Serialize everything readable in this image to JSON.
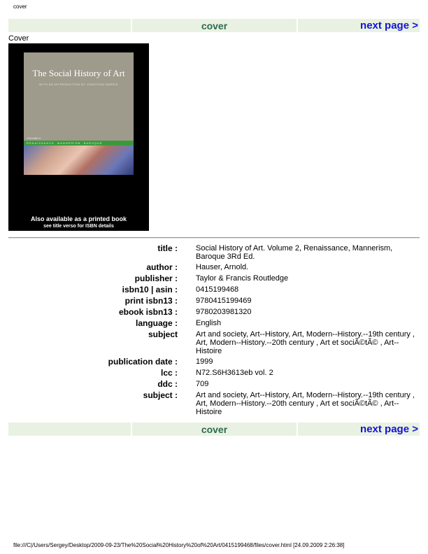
{
  "header": {
    "title": "cover"
  },
  "nav": {
    "cover_label": "cover",
    "next_label": "next page >"
  },
  "cover_section": {
    "label": "Cover",
    "book_title": "The Social History of Art",
    "introduction": "WITH AN INTRODUCTION BY JONATHAN HARRIS",
    "volume": "VOLUME II",
    "subtitle": "RENAISSANCE, MANNERISM, BAROQUE",
    "printed_note": "Also available as a printed book",
    "isbn_note": "see title verso for ISBN details"
  },
  "metadata": [
    {
      "label": "title :",
      "value": "Social History of Art. Volume 2, Renaissance, Mannerism, Baroque 3Rd Ed."
    },
    {
      "label": "author :",
      "value": "Hauser, Arnold."
    },
    {
      "label": "publisher :",
      "value": "Taylor & Francis Routledge"
    },
    {
      "label": "isbn10 | asin :",
      "value": "0415199468"
    },
    {
      "label": "print isbn13 :",
      "value": "9780415199469"
    },
    {
      "label": "ebook isbn13 :",
      "value": "9780203981320"
    },
    {
      "label": "language :",
      "value": "English"
    },
    {
      "label": "subject",
      "value": "Art and society, Art--History, Art, Modern--History.--19th century , Art, Modern--History.--20th century , Art et sociÃ©tÃ© , Art--Histoire"
    },
    {
      "label": "publication date :",
      "value": "1999"
    },
    {
      "label": "lcc :",
      "value": "N72.S6H3613eb vol. 2"
    },
    {
      "label": "ddc :",
      "value": "709"
    },
    {
      "label": "subject :",
      "value": "Art and society, Art--History, Art, Modern--History.--19th century , Art, Modern--History.--20th century , Art et sociÃ©tÃ© , Art--Histoire"
    }
  ],
  "footer": {
    "path": "file:///C|/Users/Sergey/Desktop/2009-09-23/The%20Social%20History%20of%20Art/0415199468/files/cover.html [24.09.2009 2:26:38]"
  }
}
